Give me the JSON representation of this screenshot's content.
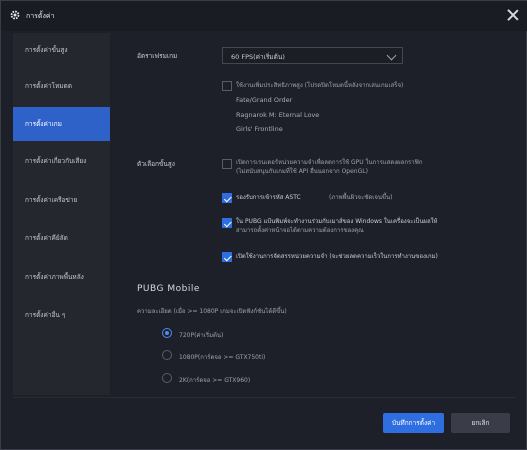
{
  "window": {
    "title": "การตั้งค่า",
    "icon": "gear-icon"
  },
  "sidebar": {
    "items": [
      {
        "label": "การตั้งค่าขั้นสูง",
        "active": false
      },
      {
        "label": "การตั้งค่าโหมดต",
        "active": false
      },
      {
        "label": "การตั้งค่าเกม",
        "active": true
      },
      {
        "label": "การตั้งค่าเกี่ยวกับเสียง",
        "active": false
      },
      {
        "label": "การตั้งค่าเครือข่าย",
        "active": false
      },
      {
        "label": "การตั้งค่าคีย์ลัด",
        "active": false
      },
      {
        "label": "การตั้งค่าภาพพื้นหลัง",
        "active": false
      },
      {
        "label": "การตั้งค่าอื่น ๆ",
        "active": false
      }
    ]
  },
  "frame_rate": {
    "label": "อัตราเฟรมเกม",
    "selected": "60 FPS(ค่าเริ่มต้น)",
    "option_text": "ใช้งานเพิ่มประสิทธิภาพสูง (โปรดปิดโหมดนี้หลังจากเล่นเกมเสร็จ)",
    "games": [
      "Fate/Grand Order",
      "Ragnarok M: Eternal Love",
      "Girls' Frontline"
    ]
  },
  "advanced": {
    "label": "ตัวเลือกขั้นสูง",
    "options": [
      {
        "text": "เปิดการเรนเดอร์หน่วยความจำเพื่อลดการใช้ GPU ในการแสดงผลกราฟิก",
        "text2": "(ไม่สนับสนุนกับเกมที่ใช้ API อื่นนอกจาก OpenGL)",
        "checked": false
      },
      {
        "text": "รองรับการเข้ารหัส ASTC",
        "text2": "(ภาพพื้นผิวจะชัดเจนขึ้น)",
        "checked": true
      },
      {
        "text": "ใน PUBG แป้นพิมพ์จะทำงานร่วมกับเมาส์ของ Windows ในเครื่องจะเป็นผลให้",
        "text2": "สามารถตั้งค่าหน้าจอได้ตามความต้องการของคุณ",
        "checked": true
      },
      {
        "text": "เปิดใช้งานการจัดสรรหน่วยความจำ (จะช่วยลดความเร็วในการทำงานของเกม)",
        "text2": "",
        "checked": true
      }
    ]
  },
  "pubg": {
    "title": "PUBG Mobile",
    "resolution_label": "ความละเอียด (เมื่อ >= 1080P เกมจะเปิดฟังก์ชันได้ดีขึ้น)",
    "options": [
      {
        "label": "720P(ค่าเริ่มต้น)",
        "selected": true
      },
      {
        "label": "1080P(การ์ดจอ >= GTX750ti)",
        "selected": false
      },
      {
        "label": "2K(การ์ดจอ >= GTX960)",
        "selected": false
      }
    ]
  },
  "footer": {
    "save_label": "บันทึกการตั้งค่า",
    "cancel_label": "ยกเลิก"
  },
  "colors": {
    "accent": "#2f6ee0",
    "sidebar_active": "#2f62c9",
    "background": "#1e2029"
  }
}
